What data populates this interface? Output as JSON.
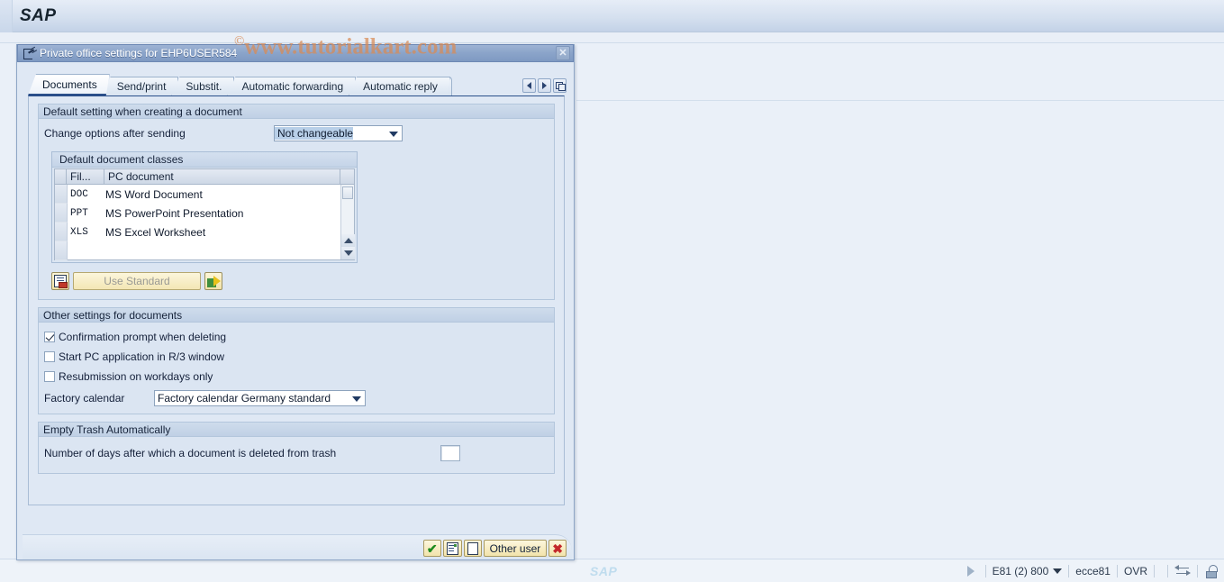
{
  "app": {
    "logo": "SAP",
    "watermark_c": "©",
    "watermark": "www.tutorialkart.com"
  },
  "dialog": {
    "title": "Private office settings for EHP6USER584",
    "title_icon": "open-window-icon",
    "close_label": "✕",
    "tabs": [
      {
        "label": "Documents",
        "active": true
      },
      {
        "label": "Send/print",
        "active": false
      },
      {
        "label": "Substit.",
        "active": false
      },
      {
        "label": "Automatic forwarding",
        "active": false
      },
      {
        "label": "Automatic reply",
        "active": false
      }
    ],
    "tab_nav": {
      "prev_icon": "chevron-left-icon",
      "next_icon": "chevron-right-icon",
      "list_icon": "tab-list-icon"
    },
    "groups": {
      "default_setting": {
        "header": "Default setting when creating a document",
        "change_options_label": "Change options after sending",
        "change_options_value": "Not changeable",
        "table": {
          "title": "Default document classes",
          "columns": [
            "Fil...",
            "PC document"
          ],
          "rows": [
            {
              "ext": "DOC",
              "name": "MS Word Document"
            },
            {
              "ext": "PPT",
              "name": "MS PowerPoint Presentation"
            },
            {
              "ext": "XLS",
              "name": "MS Excel Worksheet"
            }
          ]
        },
        "buttons": {
          "list_icon": "document-list-icon",
          "use_standard": "Use Standard",
          "export_icon": "green-arrow-icon"
        }
      },
      "other_settings": {
        "header": "Other settings for documents",
        "checkboxes": [
          {
            "label": "Confirmation prompt when deleting",
            "checked": true
          },
          {
            "label": "Start PC application in R/3 window",
            "checked": false
          },
          {
            "label": "Resubmission on workdays only",
            "checked": false
          }
        ],
        "factory_calendar_label": "Factory calendar",
        "factory_calendar_value": "Factory calendar Germany standard"
      },
      "empty_trash": {
        "header": "Empty Trash Automatically",
        "days_label": "Number of days after which a document is deleted from trash",
        "days_value": ""
      }
    },
    "footer_buttons": [
      {
        "name": "continue-button",
        "icon": "green-check-icon",
        "label": "✔"
      },
      {
        "name": "details-button",
        "icon": "document-lines-icon",
        "label": ""
      },
      {
        "name": "new-document-button",
        "icon": "blank-document-icon",
        "label": ""
      },
      {
        "name": "other-user-button",
        "icon": "",
        "label": "Other user"
      },
      {
        "name": "cancel-button",
        "icon": "red-x-icon",
        "label": "✖"
      }
    ]
  },
  "status_bar": {
    "sap_mark": "SAP",
    "play_icon": "triangle-right-icon",
    "system": "E81 (2) 800",
    "caret_icon": "caret-down-icon",
    "server": "ecce81",
    "mode": "OVR",
    "transfer_icon": "data-transfer-icon",
    "lock_icon": "unlocked-padlock-icon"
  }
}
